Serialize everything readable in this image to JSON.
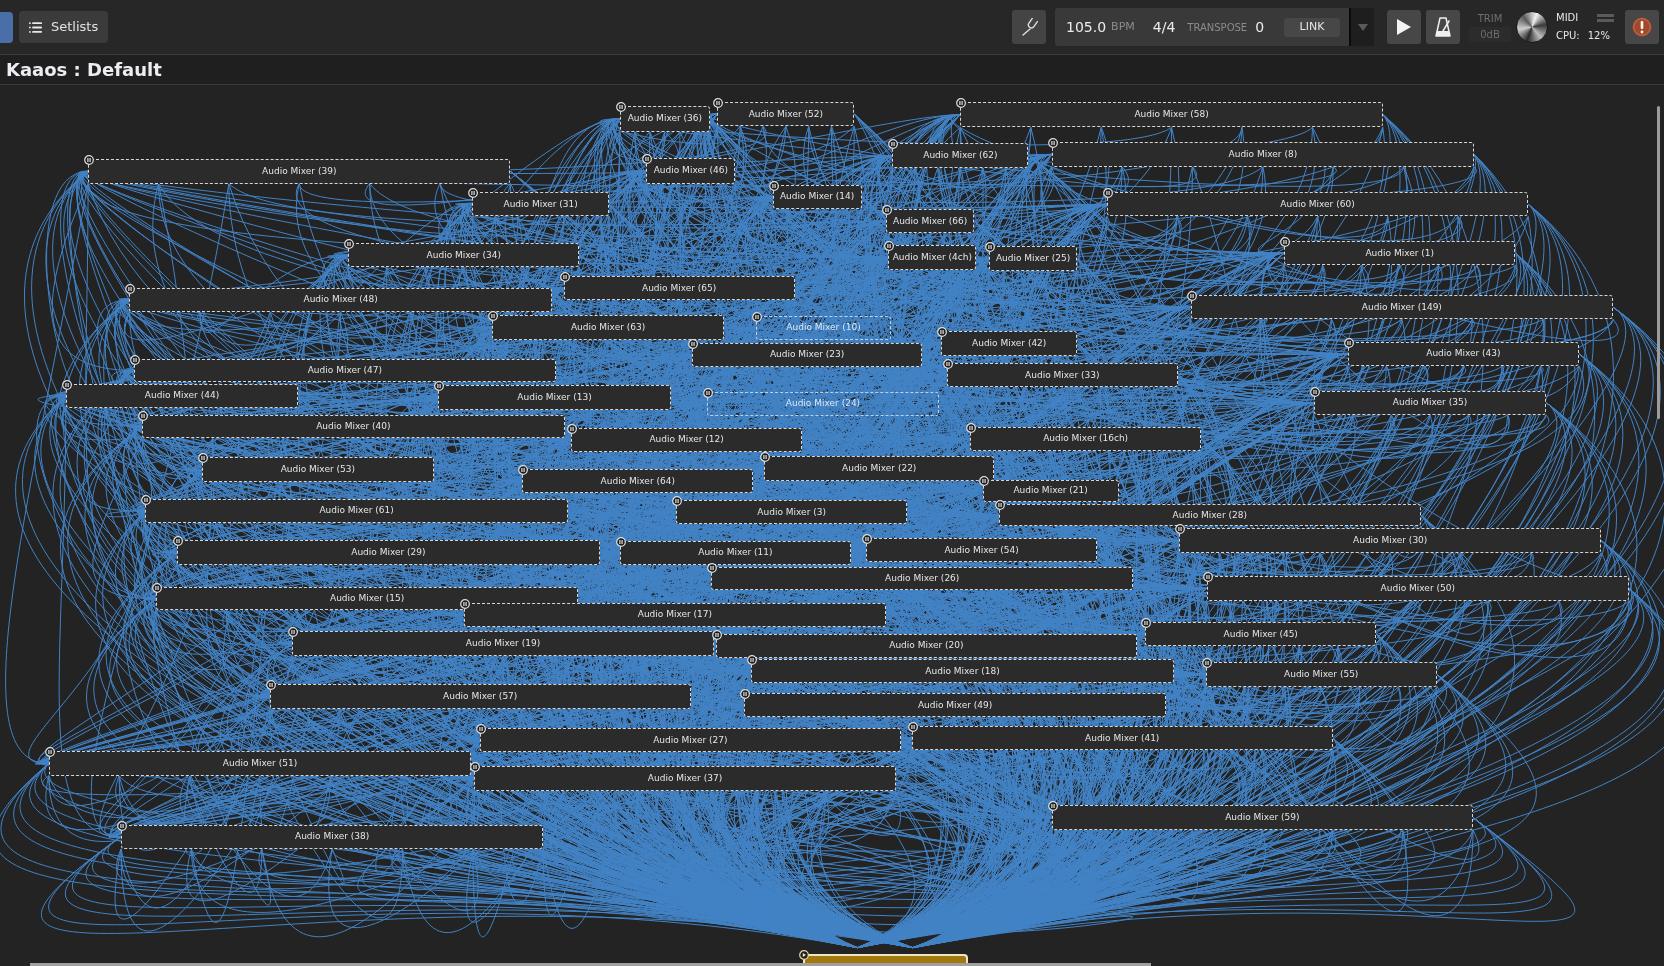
{
  "nav_tabs": [
    {
      "kind": "panel",
      "selected": true
    },
    {
      "kind": "setlists",
      "label": "Setlists",
      "selected": false
    }
  ],
  "transport": {
    "tempo": "105.0",
    "tempo_unit": "BPM",
    "time_signature": "4/4",
    "transpose_label": "TRANSPOSE",
    "transpose": "0",
    "link": "LINK"
  },
  "trim": {
    "label": "TRIM",
    "value": "0dB"
  },
  "status": {
    "midi_label": "MIDI",
    "cpu_label": "CPU:",
    "cpu_value": "12%"
  },
  "title": "Kaaos : Default",
  "graph": {
    "nodes": [
      {
        "kind": "mixer",
        "label": "Audio Mixer (36)"
      },
      {
        "kind": "mixer",
        "label": "Audio Mixer (52)"
      },
      {
        "kind": "mixer",
        "label": "Audio Mixer (58)"
      },
      {
        "kind": "mixer",
        "label": "Audio Mixer (39)"
      },
      {
        "kind": "mixer",
        "label": "Audio Mixer (46)"
      },
      {
        "kind": "mixer",
        "label": "Audio Mixer (62)"
      },
      {
        "kind": "mixer",
        "label": "Audio Mixer (8)"
      },
      {
        "kind": "mixer",
        "label": "Audio Mixer (31)"
      },
      {
        "kind": "mixer",
        "label": "Audio Mixer (14)"
      },
      {
        "kind": "mixer",
        "label": "Audio Mixer (60)"
      },
      {
        "kind": "mixer",
        "label": "Audio Mixer (66)"
      },
      {
        "kind": "mixer",
        "label": "Audio Mixer (34)"
      },
      {
        "kind": "mixer",
        "label": "Audio Mixer (4ch)"
      },
      {
        "kind": "mixer",
        "label": "Audio Mixer (25)"
      },
      {
        "kind": "mixer",
        "label": "Audio Mixer (1)"
      },
      {
        "kind": "mixer",
        "label": "Audio Mixer (65)"
      },
      {
        "kind": "mixer",
        "label": "Audio Mixer (48)"
      },
      {
        "kind": "mixer",
        "label": "Audio Mixer (149)"
      },
      {
        "kind": "mixer",
        "label": "Audio Mixer (63)"
      },
      {
        "kind": "ghost",
        "label": "Audio Mixer (10)"
      },
      {
        "kind": "mixer",
        "label": "Audio Mixer (42)"
      },
      {
        "kind": "mixer",
        "label": "Audio Mixer (23)"
      },
      {
        "kind": "mixer",
        "label": "Audio Mixer (43)"
      },
      {
        "kind": "mixer",
        "label": "Audio Mixer (47)"
      },
      {
        "kind": "mixer",
        "label": "Audio Mixer (33)"
      },
      {
        "kind": "mixer",
        "label": "Audio Mixer (44)"
      },
      {
        "kind": "mixer",
        "label": "Audio Mixer (13)"
      },
      {
        "kind": "ghost",
        "label": "Audio Mixer (24)"
      },
      {
        "kind": "mixer",
        "label": "Audio Mixer (35)"
      },
      {
        "kind": "mixer",
        "label": "Audio Mixer (40)"
      },
      {
        "kind": "mixer",
        "label": "Audio Mixer (12)"
      },
      {
        "kind": "mixer",
        "label": "Audio Mixer (16ch)"
      },
      {
        "kind": "mixer",
        "label": "Audio Mixer (53)"
      },
      {
        "kind": "mixer",
        "label": "Audio Mixer (22)"
      },
      {
        "kind": "mixer",
        "label": "Audio Mixer (64)"
      },
      {
        "kind": "mixer",
        "label": "Audio Mixer (21)"
      },
      {
        "kind": "mixer",
        "label": "Audio Mixer (61)"
      },
      {
        "kind": "mixer",
        "label": "Audio Mixer (3)"
      },
      {
        "kind": "mixer",
        "label": "Audio Mixer (28)"
      },
      {
        "kind": "mixer",
        "label": "Audio Mixer (30)"
      },
      {
        "kind": "mixer",
        "label": "Audio Mixer (29)"
      },
      {
        "kind": "mixer",
        "label": "Audio Mixer (11)"
      },
      {
        "kind": "mixer",
        "label": "Audio Mixer (54)"
      },
      {
        "kind": "mixer",
        "label": "Audio Mixer (26)"
      },
      {
        "kind": "mixer",
        "label": "Audio Mixer (50)"
      },
      {
        "kind": "mixer",
        "label": "Audio Mixer (15)"
      },
      {
        "kind": "mixer",
        "label": "Audio Mixer (17)"
      },
      {
        "kind": "mixer",
        "label": "Audio Mixer (19)"
      },
      {
        "kind": "mixer",
        "label": "Audio Mixer (20)"
      },
      {
        "kind": "mixer",
        "label": "Audio Mixer (45)"
      },
      {
        "kind": "mixer",
        "label": "Audio Mixer (18)"
      },
      {
        "kind": "mixer",
        "label": "Audio Mixer (55)"
      },
      {
        "kind": "mixer",
        "label": "Audio Mixer (57)"
      },
      {
        "kind": "mixer",
        "label": "Audio Mixer (49)"
      },
      {
        "kind": "mixer",
        "label": "Audio Mixer (27)"
      },
      {
        "kind": "mixer",
        "label": "Audio Mixer (41)"
      },
      {
        "kind": "mixer",
        "label": "Audio Mixer (51)"
      },
      {
        "kind": "mixer",
        "label": "Audio Mixer (37)"
      },
      {
        "kind": "mixer",
        "label": "Audio Mixer (59)"
      },
      {
        "kind": "mixer",
        "label": "Audio Mixer (38)"
      },
      {
        "kind": "output"
      }
    ]
  }
}
